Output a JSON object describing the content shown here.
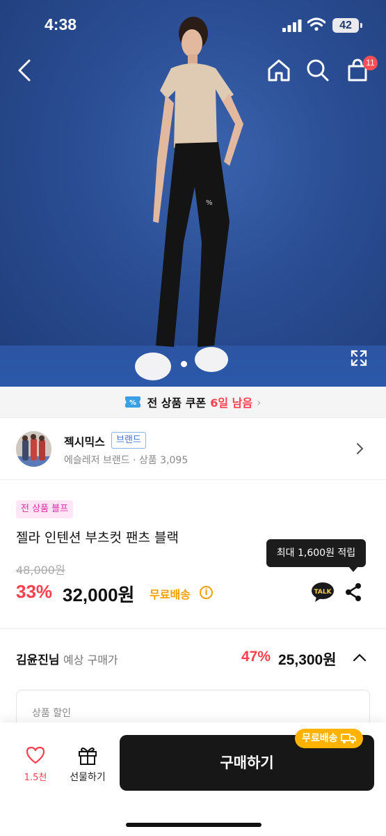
{
  "status_bar": {
    "time": "4:38",
    "battery": "42"
  },
  "nav": {
    "cart_count": "11"
  },
  "coupon_bar": {
    "text": "전 상품 쿠폰",
    "highlight": "6일 남음",
    "chevron": "›"
  },
  "brand": {
    "name": "젝시믹스",
    "tag": "브랜드",
    "subtitle": "에슬레저 브랜드 · 상품 3,095"
  },
  "product": {
    "badge": "전 상품 블프",
    "title": "젤라 인텐션 부츠컷 팬츠 블랙",
    "tooltip": "최대 1,600원 적립",
    "original_price": "48,000원",
    "discount": "33%",
    "price": "32,000원",
    "shipping": "무료배송",
    "info_icon": "i",
    "talk": "TALK"
  },
  "expected_price": {
    "user": "김윤진님",
    "label": "예상 구매가",
    "discount": "47%",
    "price": "25,300원"
  },
  "detail": {
    "label": "상품 할인"
  },
  "bottom_bar": {
    "like_count": "1.5천",
    "gift_label": "선물하기",
    "buy_label": "구매하기",
    "free_shipping": "무료배송"
  },
  "colors": {
    "accent_red": "#ff3f4c",
    "brand_blue": "#3f74d6",
    "shipping_orange": "#f5a000",
    "buy_button": "#171717"
  }
}
